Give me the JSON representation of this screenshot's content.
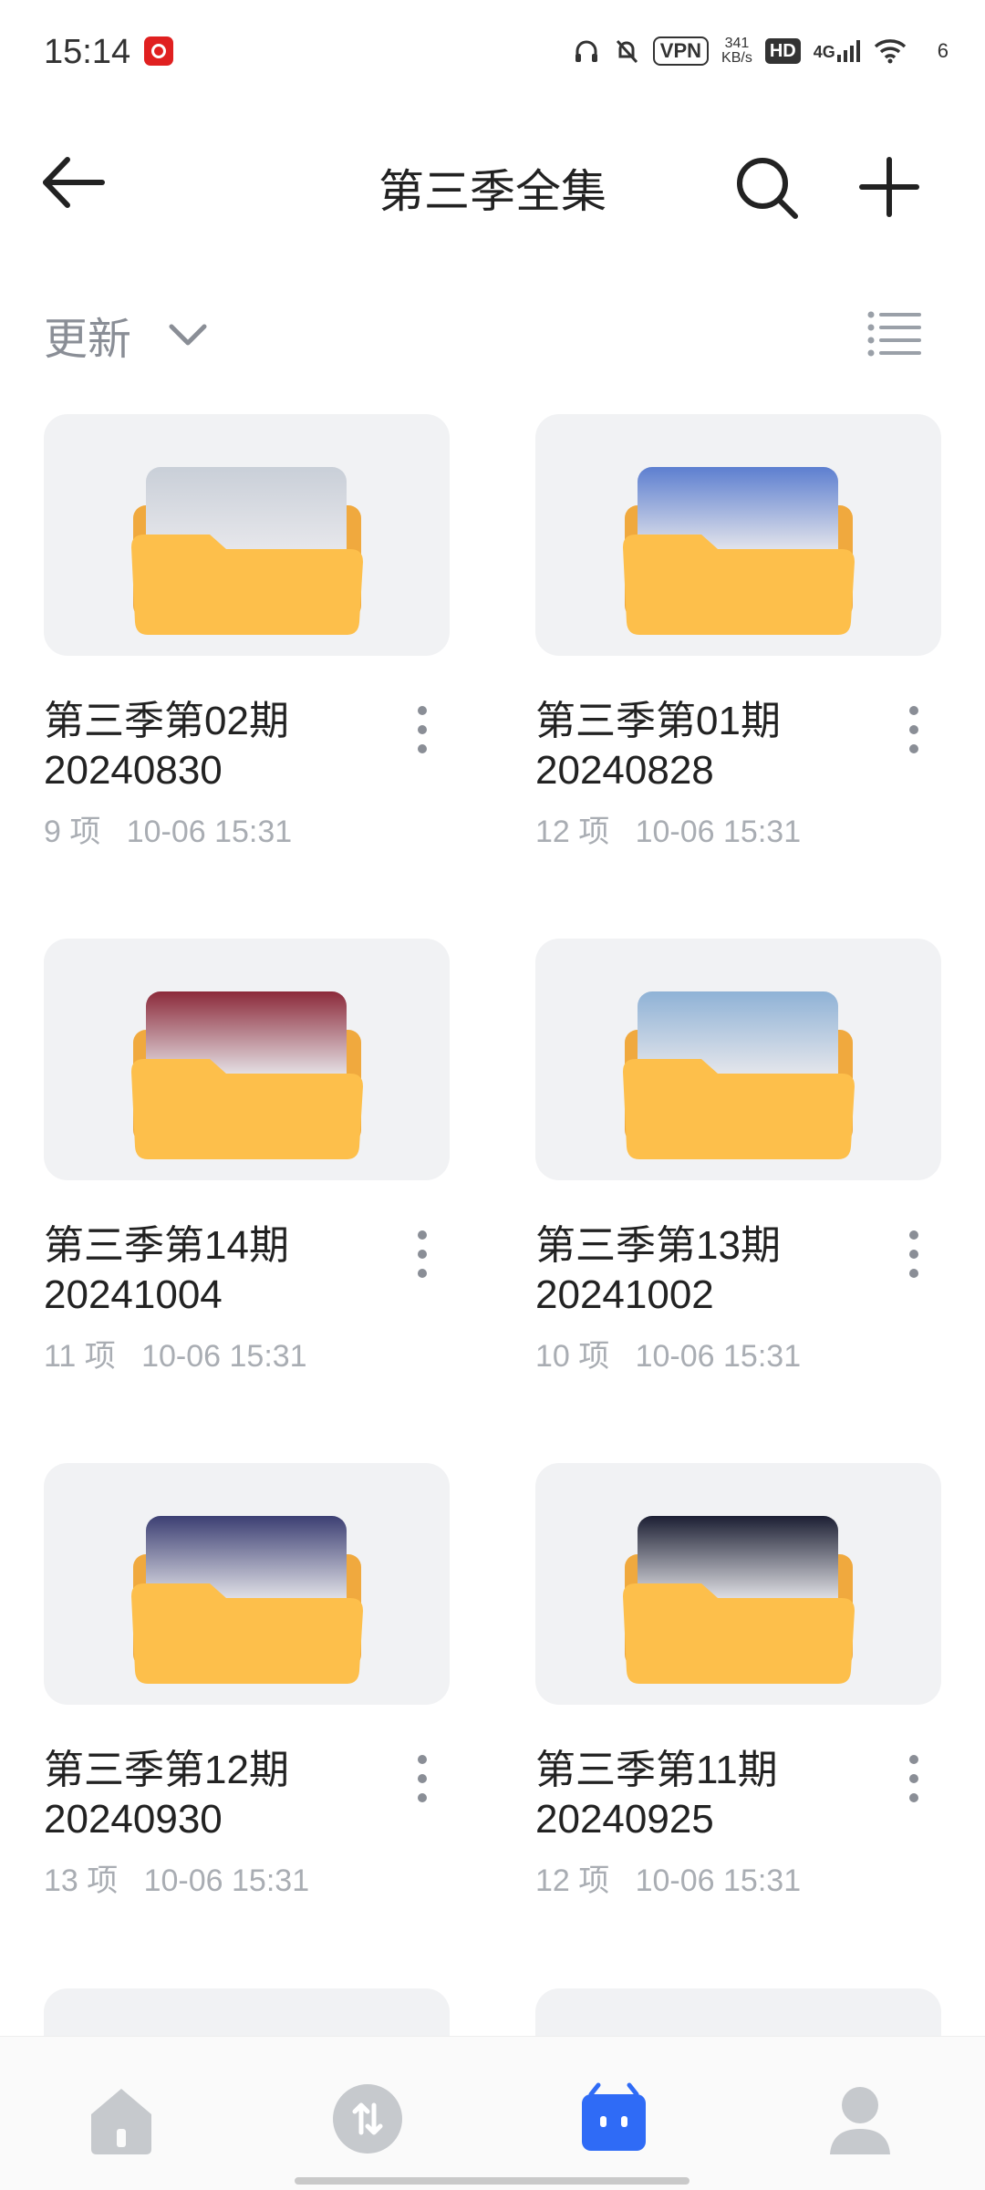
{
  "status_bar": {
    "time": "15:14",
    "vpn": "VPN",
    "speed_value": "341",
    "speed_unit": "KB/s",
    "hd": "HD",
    "network": "4G",
    "battery": "6"
  },
  "header": {
    "title": "第三季全集",
    "icons": [
      "back-arrow-icon",
      "search-icon",
      "plus-icon"
    ]
  },
  "sort": {
    "label": "更新",
    "icons": [
      "chevron-down-icon",
      "list-view-icon"
    ]
  },
  "colors": {
    "folder": "#fdbf4b",
    "folder_back": "#f0a93e",
    "card_bg": "#f1f2f4",
    "accent": "#2f6bf6",
    "muted_text": "#a9adb3"
  },
  "folders": [
    {
      "title": "第三季第02期\n20240830",
      "count": "9 项",
      "meta": "10-06 15:31",
      "thumb": "#c9cfd8"
    },
    {
      "title": "第三季第01期\n20240828",
      "count": "12 项",
      "meta": "10-06 15:31",
      "thumb": "#5d7fd0"
    },
    {
      "title": "第三季第14期\n20241004",
      "count": "11 项",
      "meta": "10-06 15:31",
      "thumb": "#8c2a3a"
    },
    {
      "title": "第三季第13期\n20241002",
      "count": "10 项",
      "meta": "10-06 15:31",
      "thumb": "#8fb2d6"
    },
    {
      "title": "第三季第12期\n20240930",
      "count": "13 项",
      "meta": "10-06 15:31",
      "thumb": "#3c3f73"
    },
    {
      "title": "第三季第11期\n20240925",
      "count": "12 项",
      "meta": "10-06 15:31",
      "thumb": "#1c1f33"
    }
  ],
  "bottom_nav": [
    "home-icon",
    "transfer-icon",
    "files-icon",
    "profile-icon"
  ]
}
